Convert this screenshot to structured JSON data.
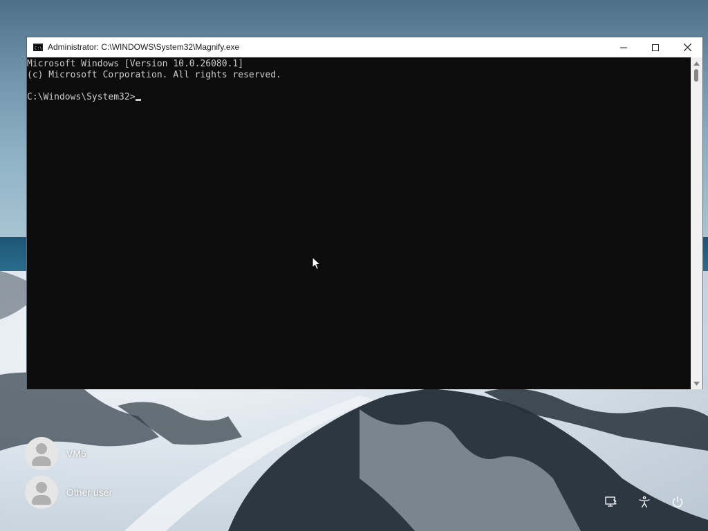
{
  "window": {
    "title": "Administrator: C:\\WINDOWS\\System32\\Magnify.exe",
    "icon": "console-icon",
    "controls": [
      "minimize-icon",
      "maximize-icon",
      "close-icon"
    ]
  },
  "terminal": {
    "lines": [
      "Microsoft Windows [Version 10.0.26080.1]",
      "(c) Microsoft Corporation. All rights reserved.",
      "",
      "C:\\Windows\\System32>"
    ]
  },
  "login": {
    "users": [
      {
        "name": "VM6"
      },
      {
        "name": "Other user"
      }
    ],
    "system_icons": [
      "network-icon",
      "accessibility-icon",
      "power-icon"
    ]
  },
  "colors": {
    "terminal_bg": "#0c0c0c",
    "terminal_text": "#cccccc",
    "titlebar_bg": "#ffffff"
  }
}
